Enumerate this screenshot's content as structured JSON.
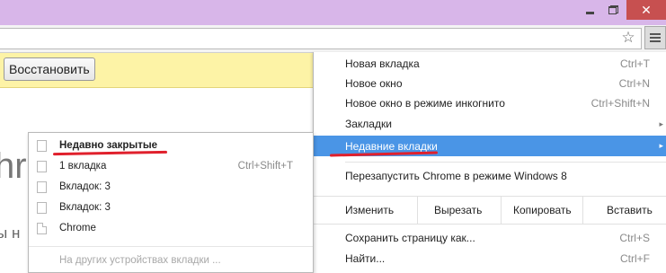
{
  "window": {
    "controls": [
      "minimize-icon",
      "maximize-icon",
      "close-icon"
    ],
    "close_glyph": "✕",
    "titlebar_color": "#d8b6e9"
  },
  "toolbar": {
    "star_glyph": "☆",
    "menu_icon": "hamburger-menu-icon"
  },
  "infobar": {
    "restore_label": "Восстановить",
    "color": "#fdf3a6"
  },
  "page": {
    "big_text": "hr",
    "small_text": "ы н"
  },
  "menu": {
    "items": [
      {
        "label": "Новая вкладка",
        "shortcut": "Ctrl+T"
      },
      {
        "label": "Новое окно",
        "shortcut": "Ctrl+N"
      },
      {
        "label": "Новое окно в режиме инкогнито",
        "shortcut": "Ctrl+Shift+N"
      },
      {
        "label": "Закладки",
        "arrow": "▸"
      },
      {
        "label": "Недавние вкладки",
        "arrow": "▸"
      },
      {
        "label": "Перезапустить Chrome в режиме Windows 8"
      },
      {
        "label": "Сохранить страницу как...",
        "shortcut": "Ctrl+S"
      },
      {
        "label": "Найти...",
        "shortcut": "Ctrl+F"
      }
    ],
    "edit": {
      "label": "Изменить",
      "cut": "Вырезать",
      "copy": "Копировать",
      "paste": "Вставить"
    },
    "highlight_color": "#4a95e6"
  },
  "submenu": {
    "header": "Недавно закрытые",
    "items": [
      {
        "label": "1 вкладка",
        "shortcut": "Ctrl+Shift+T"
      },
      {
        "label": "Вкладок: 3"
      },
      {
        "label": "Вкладок: 3"
      },
      {
        "label": "Chrome"
      }
    ],
    "other_devices": "На других устройствах вкладки ..."
  },
  "annotation_color": "#e0202c"
}
